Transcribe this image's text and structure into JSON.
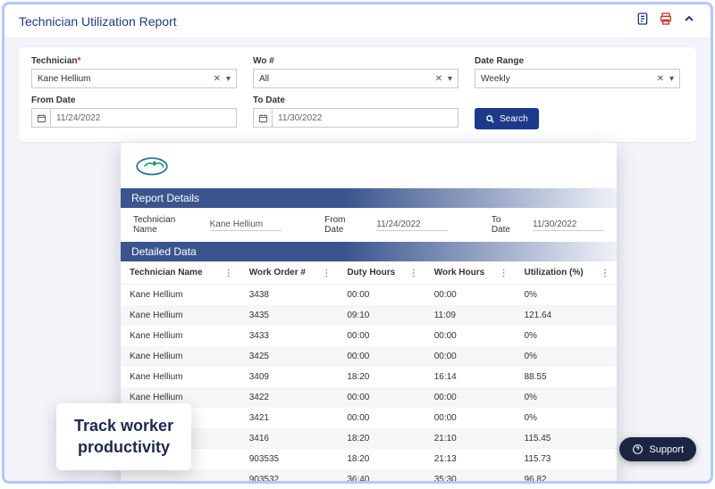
{
  "header": {
    "title": "Technician Utilization Report"
  },
  "filters": {
    "technician_label": "Technician",
    "technician_value": "Kane Hellium",
    "wo_label": "Wo #",
    "wo_value": "All",
    "daterange_label": "Date Range",
    "daterange_value": "Weekly",
    "fromdate_label": "From Date",
    "fromdate_value": "11/24/2022",
    "todate_label": "To Date",
    "todate_value": "11/30/2022",
    "search_label": "Search"
  },
  "report": {
    "details_title": "Report Details",
    "technician_name_label": "Technician Name",
    "technician_name_value": "Kane Hellium",
    "from_label": "From Date",
    "from_value": "11/24/2022",
    "to_label": "To Date",
    "to_value": "11/30/2022",
    "data_title": "Detailed Data",
    "columns": {
      "c0": "Technician Name",
      "c1": "Work Order #",
      "c2": "Duty Hours",
      "c3": "Work Hours",
      "c4": "Utilization (%)"
    },
    "rows": [
      {
        "tech": "Kane Hellium",
        "wo": "3438",
        "duty": "00:00",
        "work": "00:00",
        "util": "0%"
      },
      {
        "tech": "Kane Hellium",
        "wo": "3435",
        "duty": "09:10",
        "work": "11:09",
        "util": "121.64"
      },
      {
        "tech": "Kane Hellium",
        "wo": "3433",
        "duty": "00:00",
        "work": "00:00",
        "util": "0%"
      },
      {
        "tech": "Kane Hellium",
        "wo": "3425",
        "duty": "00:00",
        "work": "00:00",
        "util": "0%"
      },
      {
        "tech": "Kane Hellium",
        "wo": "3409",
        "duty": "18:20",
        "work": "16:14",
        "util": "88.55"
      },
      {
        "tech": "Kane Hellium",
        "wo": "3422",
        "duty": "00:00",
        "work": "00:00",
        "util": "0%"
      },
      {
        "tech": "Kane Hellium",
        "wo": "3421",
        "duty": "00:00",
        "work": "00:00",
        "util": "0%"
      },
      {
        "tech": "",
        "wo": "3416",
        "duty": "18:20",
        "work": "21:10",
        "util": "115.45"
      },
      {
        "tech": "",
        "wo": "903535",
        "duty": "18:20",
        "work": "21:13",
        "util": "115.73"
      },
      {
        "tech": "",
        "wo": "903532",
        "duty": "36:40",
        "work": "35:30",
        "util": "96.82"
      }
    ]
  },
  "callout": {
    "line1": "Track worker",
    "line2": "productivity"
  },
  "support": {
    "label": "Support"
  }
}
